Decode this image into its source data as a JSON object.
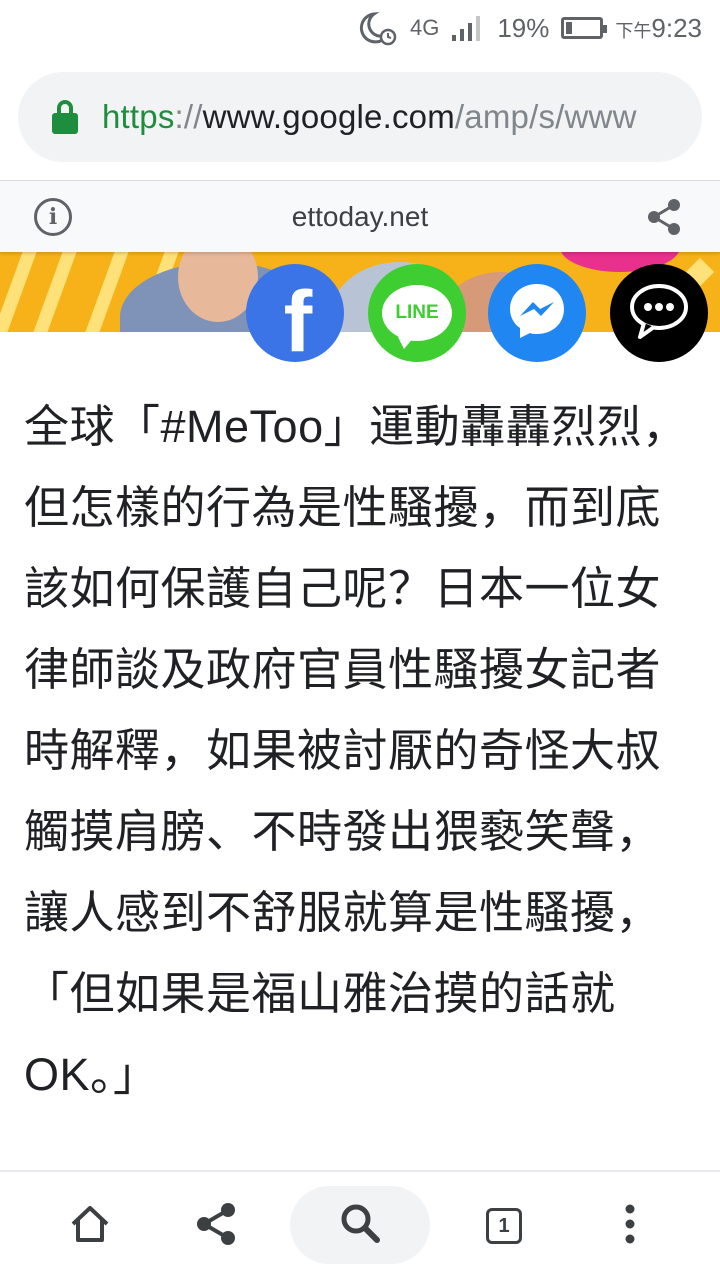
{
  "status_bar": {
    "network": "4G",
    "battery_percent": "19%",
    "battery_level": 0.19,
    "time_prefix": "下午",
    "time": "9:23",
    "icons": [
      "moon-alarm-icon",
      "signal-icon",
      "battery-icon"
    ]
  },
  "url_bar": {
    "scheme": "https",
    "separator": "://",
    "host": "www.google.com",
    "path": "/amp/s/www",
    "lock_icon": "lock-icon"
  },
  "amp_header": {
    "domain": "ettoday.net",
    "info_icon": "info-icon",
    "share_icon": "share-icon"
  },
  "social_buttons": {
    "facebook_label": "f",
    "line_label": "LINE",
    "messenger_icon": "messenger-icon",
    "more_icon": "chat-more-icon"
  },
  "article": {
    "paragraph": "全球「#MeToo」運動轟轟烈烈，但怎樣的行為是性騷擾，而到底該如何保護自己呢？日本一位女律師談及政府官員性騷擾女記者時解釋，如果被討厭的奇怪大叔觸摸肩膀、不時發出猥褻笑聲，讓人感到不舒服就算是性騷擾，「但如果是福山雅治摸的話就OK。」"
  },
  "toolbar": {
    "tab_count": "1",
    "icons": [
      "home-icon",
      "share-icon",
      "search-icon",
      "tabs-icon",
      "more-vert-icon"
    ]
  },
  "colors": {
    "secure_green": "#1e8e3e",
    "hero_yellow": "#f7b21a",
    "facebook": "#3b74e6",
    "line": "#3fce32",
    "messenger": "#1f86f2"
  }
}
